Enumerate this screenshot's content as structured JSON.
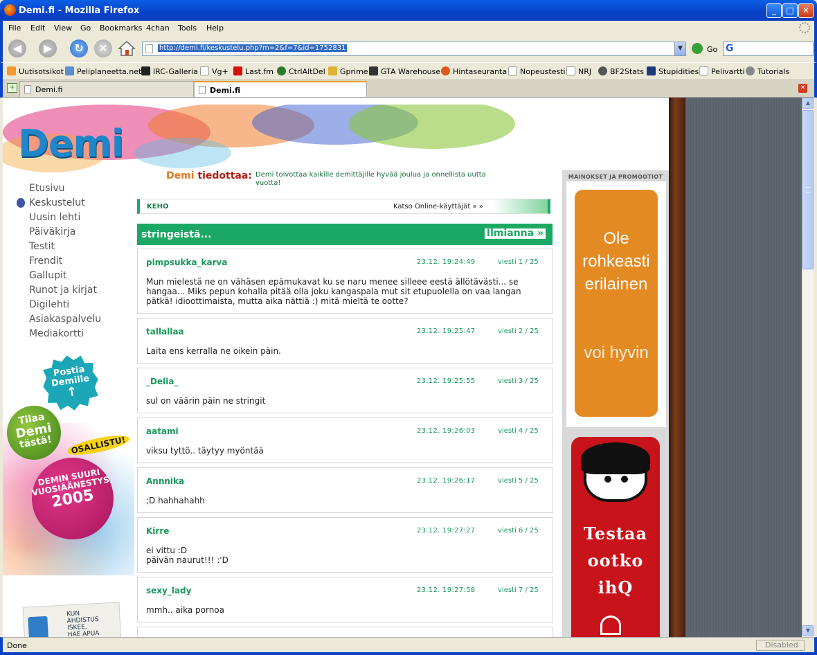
{
  "window": {
    "title": "Demi.fi - Mozilla Firefox"
  },
  "menu": [
    "File",
    "Edit",
    "View",
    "Go",
    "Bookmarks",
    "4chan",
    "Tools",
    "Help"
  ],
  "nav": {
    "url": "http://demi.fi/keskustelu.php?m=2&f=7&id=1752831",
    "go_label": "Go",
    "search_icon": "G"
  },
  "bookmarks": [
    "Uutisotsikot",
    "Peliplaneetta.net",
    "IRC-Galleria",
    "Vg+",
    "Last.fm",
    "CtrlAltDel",
    "Gprime",
    "GTA Warehouse",
    "Hintaseuranta",
    "Nopeustesti",
    "NRJ",
    "BF2Stats",
    "Stupidities",
    "Pelivartti",
    "Tutorials"
  ],
  "tabs": [
    {
      "label": "Demi.fi"
    },
    {
      "label": "Demi.fi"
    }
  ],
  "status": {
    "text": "Done",
    "right": "Disabled"
  },
  "page": {
    "logo": "Demi",
    "tiedottaa_demi": "Demi",
    "tiedottaa_word": " tiedottaa:",
    "notice": "Demi toivottaa kaikille demittäjille hyvää joulua ja onnellista uutta vuotta!",
    "leftnav": [
      "Etusivu",
      "Keskustelut",
      "Uusin lehti",
      "Päiväkirja",
      "Testit",
      "Frendit",
      "Gallupit",
      "Runot ja kirjat",
      "Digilehti",
      "Asiakaspalvelu",
      "Mediakortti"
    ],
    "post_badge": [
      "Postia",
      "Demille"
    ],
    "tilaa_badge": [
      "Tilaa",
      "Demi",
      "tästä!"
    ],
    "osallistu": "OSALLISTU!",
    "suuri_badge": [
      "DEMIN SUURI",
      "VUOSIÄÄNESTYS",
      "2005"
    ],
    "kun_badge": [
      "KUN",
      "AHDISTUS",
      "ISKEE,",
      "HAE APUA"
    ],
    "keho": {
      "left": "KEHO",
      "right": "Katso Online-käyttäjät » »"
    },
    "thread_title": "stringeistä...",
    "report_label": "Ilmianna »",
    "posts": [
      {
        "author": "pimpsukka_karva",
        "time": "23.12. 19:24:49",
        "num": "viesti 1 / 25",
        "body": "Mun mielestä ne on vähäsen epämukavat ku se naru menee silleee eestä ällötävästi... se hangaa... Miks pepun kohalla pitää olla joku kangaspala mut sit etupuolella on vaa langan pätkä! idioottimaista, mutta aika nättiä :) mitä mieltä te ootte?"
      },
      {
        "author": "tallallaa",
        "time": "23.12. 19:25:47",
        "num": "viesti 2 / 25",
        "body": "Laita ens kerralla ne oikein päin."
      },
      {
        "author": "_Delia_",
        "time": "23.12. 19:25:55",
        "num": "viesti 3 / 25",
        "body": "sul on väärin päin ne stringit"
      },
      {
        "author": "aatami",
        "time": "23.12. 19:26:03",
        "num": "viesti 4 / 25",
        "body": "viksu tyttö.. täytyy myöntää"
      },
      {
        "author": "Annnika",
        "time": "23.12. 19:26:17",
        "num": "viesti 5 / 25",
        "body": ";D hahhahahh"
      },
      {
        "author": "Kirre",
        "time": "23.12. 19:27:27",
        "num": "viesti 6 / 25",
        "body": "ei vittu :D\npäivän naurut!!! :'D"
      },
      {
        "author": "sexy_lady",
        "time": "23.12. 19:27:58",
        "num": "viesti 7 / 25",
        "body": "mmh.. aika pornoa"
      }
    ],
    "ads": {
      "label": "MAINOKSET JA PROMOOTIOT",
      "ad1_big": [
        "Ole",
        "rohkeasti",
        "erilainen"
      ],
      "ad1_small": "voi hyvin",
      "ad2_text": [
        "Testaa",
        "ootko",
        "ihQ"
      ]
    }
  },
  "colors": {
    "accent_green": "#1ba864",
    "link_green": "#17985a",
    "xp_blue": "#0842c7"
  }
}
